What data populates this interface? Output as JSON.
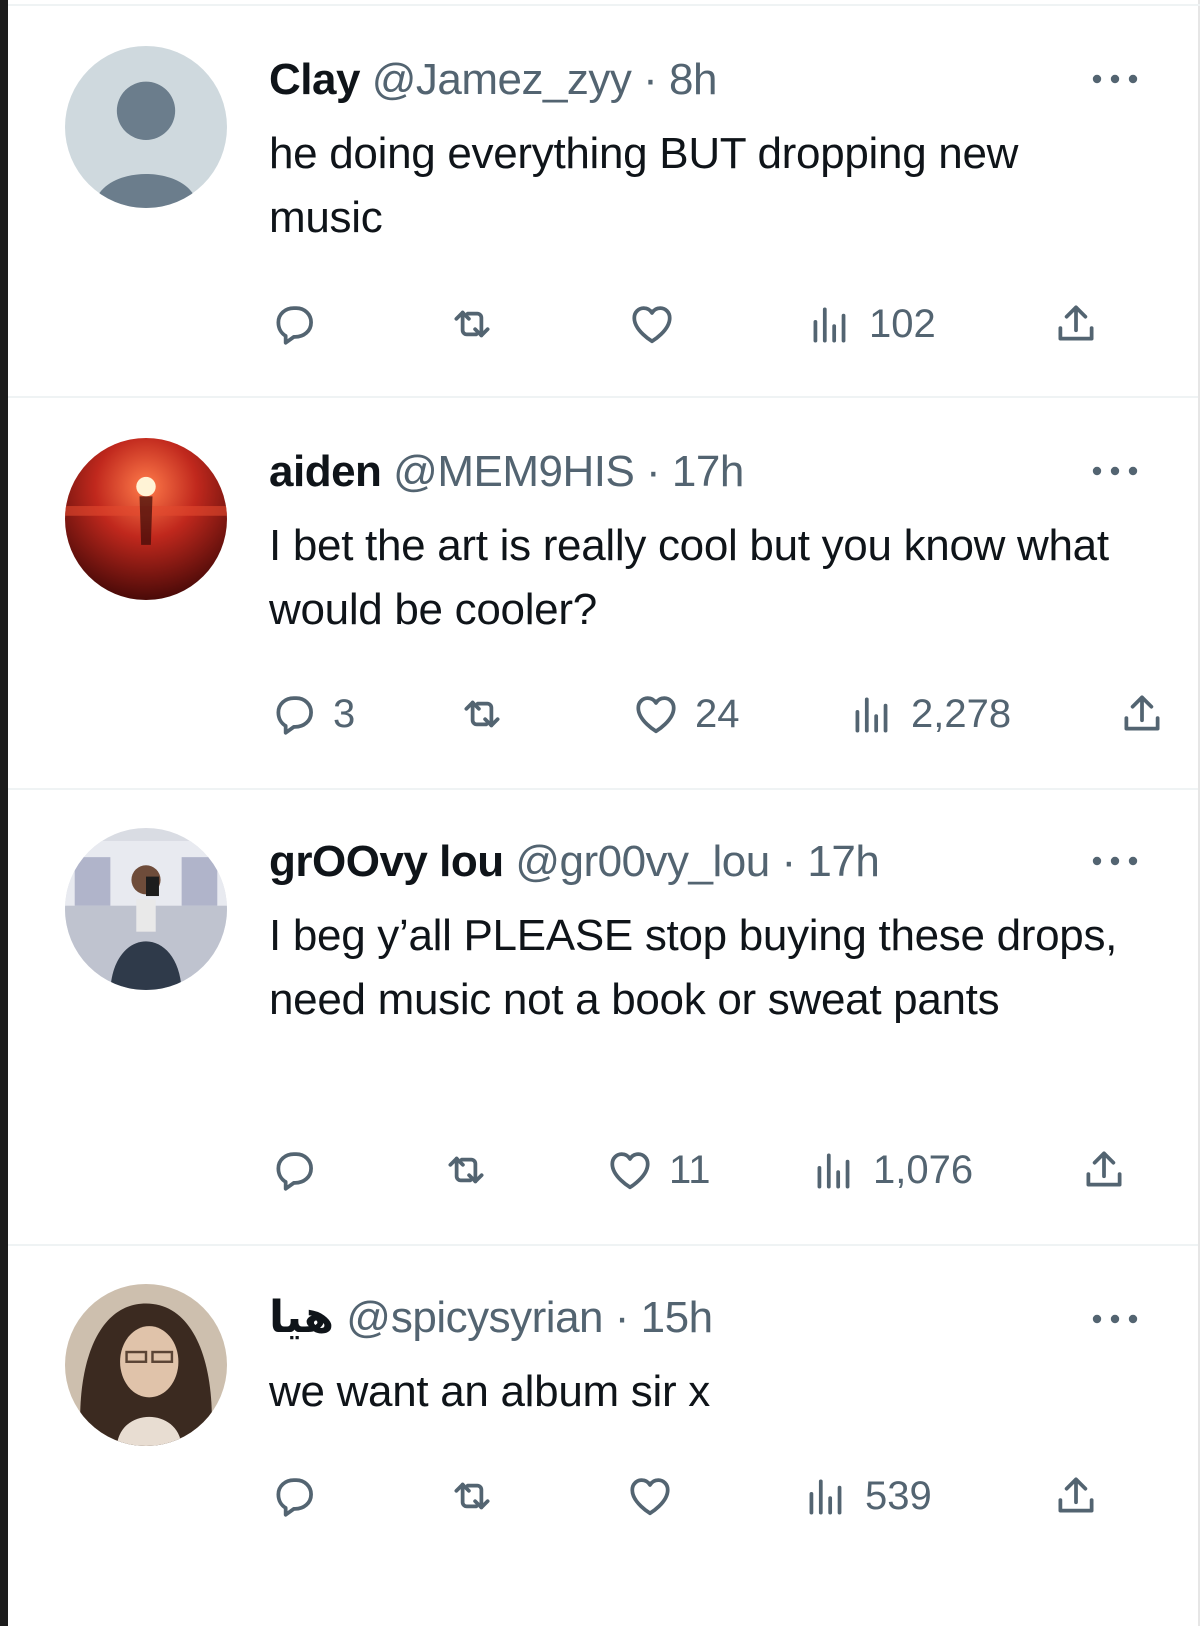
{
  "replies": [
    {
      "name": "Clay",
      "handle": "@Jamez_zyy",
      "separator": "·",
      "time": "8h",
      "text": "he doing everything BUT dropping new music",
      "metrics": {
        "replies": "",
        "reposts": "",
        "likes": "",
        "views": "102"
      },
      "avatar": "default-avatar"
    },
    {
      "name": "aiden",
      "handle": "@MEM9HIS",
      "separator": "·",
      "time": "17h",
      "text": "I bet the art is really cool but you know what would be cooler?",
      "metrics": {
        "replies": "3",
        "reposts": "",
        "likes": "24",
        "views": "2,278"
      },
      "avatar": "red-sun-avatar"
    },
    {
      "name": "grOOvy lou",
      "handle": "@gr00vy_lou",
      "separator": "·",
      "time": "17h",
      "text": "I beg y’all PLEASE stop buying these drops, need music not a book or sweat pants",
      "metrics": {
        "replies": "",
        "reposts": "",
        "likes": "11",
        "views": "1,076"
      },
      "avatar": "mirror-selfie-avatar"
    },
    {
      "name": "هيا",
      "handle": "@spicysyrian",
      "separator": "·",
      "time": "15h",
      "text": "we want an album sir x",
      "metrics": {
        "replies": "",
        "reposts": "",
        "likes": "",
        "views": "539"
      },
      "avatar": "portrait-avatar"
    }
  ],
  "colors": {
    "text": "#0f1419",
    "secondary": "#536471",
    "divider": "#eff3f4"
  },
  "icons": [
    "reply-icon",
    "repost-icon",
    "like-icon",
    "views-icon",
    "share-icon",
    "more-icon"
  ]
}
